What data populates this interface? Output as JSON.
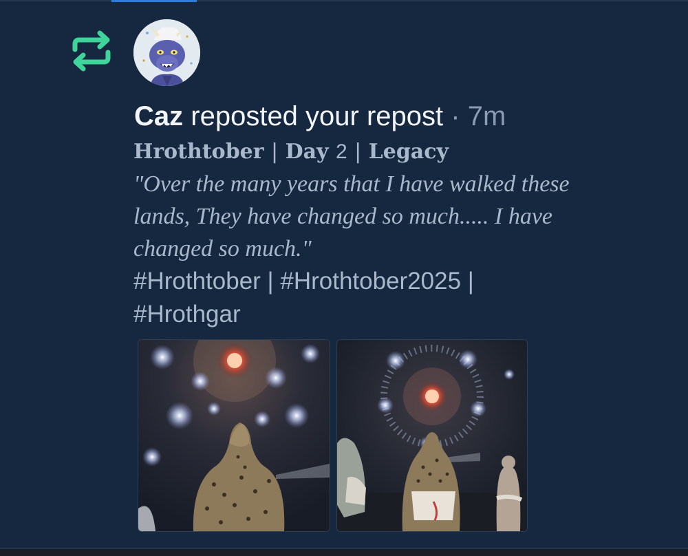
{
  "notification": {
    "user": "Caz",
    "action": "reposted your repost",
    "separator": "·",
    "time": "7m"
  },
  "post": {
    "title": {
      "part1": "Hrothtober",
      "sep1": "|",
      "day_word": "Day",
      "day_num": "2",
      "sep2": "|",
      "part3": "Legacy"
    },
    "quote_lines": [
      "\"Over the many years that I have walked these",
      "lands, They have changed so much..... I have",
      "changed so much.\""
    ],
    "hashtag_lines": [
      "#Hrothtober | #Hrothtober2025 |",
      "#Hrothgar"
    ]
  },
  "images": [
    {
      "description_icon": "fireworks-image"
    },
    {
      "description_icon": "fireworks-image"
    }
  ],
  "colors": {
    "background": "#162840",
    "repost_accent": "#3fd49a",
    "muted_text": "#8a9bb2",
    "post_text": "#a9b8cb"
  }
}
